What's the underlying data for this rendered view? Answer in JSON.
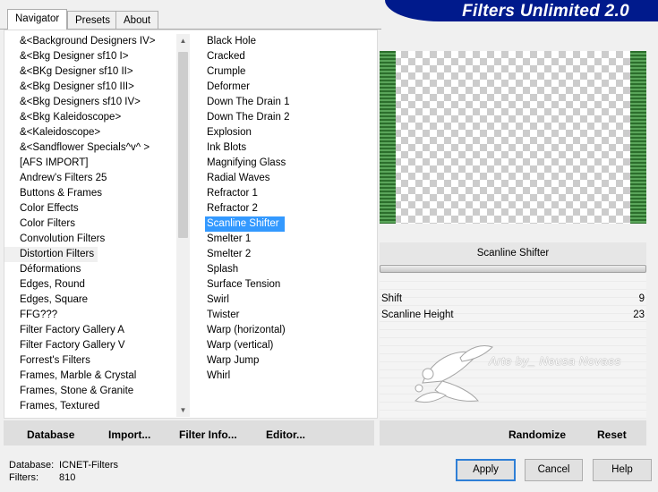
{
  "tabs": [
    "Navigator",
    "Presets",
    "About"
  ],
  "title": "Filters Unlimited 2.0",
  "categories": [
    "&<Background Designers IV>",
    "&<Bkg Designer sf10 I>",
    "&<BKg Designer sf10 II>",
    "&<Bkg Designer sf10 III>",
    "&<Bkg Designers sf10 IV>",
    "&<Bkg Kaleidoscope>",
    "&<Kaleidoscope>",
    "&<Sandflower Specials^v^ >",
    "[AFS IMPORT]",
    "Andrew's Filters 25",
    "Buttons & Frames",
    "Color Effects",
    "Color Filters",
    "Convolution Filters",
    "Distortion Filters",
    "Déformations",
    "Edges, Round",
    "Edges, Square",
    "FFG???",
    "Filter Factory Gallery A",
    "Filter Factory Gallery V",
    "Forrest's Filters",
    "Frames, Marble & Crystal",
    "Frames, Stone & Granite",
    "Frames, Textured"
  ],
  "filters": [
    "Black Hole",
    "Cracked",
    "Crumple",
    "Deformer",
    "Down The Drain 1",
    "Down The Drain 2",
    "Explosion",
    "Ink Blots",
    "Magnifying Glass",
    "Radial Waves",
    "Refractor 1",
    "Refractor 2",
    "Scanline Shifter",
    "Smelter 1",
    "Smelter 2",
    "Splash",
    "Surface Tension",
    "Swirl",
    "Twister",
    "Warp (horizontal)",
    "Warp (vertical)",
    "Warp Jump",
    "Whirl"
  ],
  "selected_category": "Distortion Filters",
  "selected_filter": "Scanline Shifter",
  "bottom_buttons": {
    "database": "Database",
    "import": "Import...",
    "filter_info": "Filter Info...",
    "editor": "Editor..."
  },
  "filter_panel": {
    "name": "Scanline Shifter",
    "params": [
      {
        "name": "Shift",
        "value": "9"
      },
      {
        "name": "Scanline Height",
        "value": "23"
      }
    ],
    "watermark": "Arte by_ Neusa Novaes",
    "randomize": "Randomize",
    "reset": "Reset"
  },
  "status": {
    "database_label": "Database:",
    "database_value": "ICNET-Filters",
    "filters_label": "Filters:",
    "filters_value": "810"
  },
  "dialog_buttons": {
    "apply": "Apply",
    "cancel": "Cancel",
    "help": "Help"
  },
  "colors": {
    "title_bar": "#001a8c",
    "selection": "#3399ff",
    "preview_edge": "#2c6e2c"
  }
}
